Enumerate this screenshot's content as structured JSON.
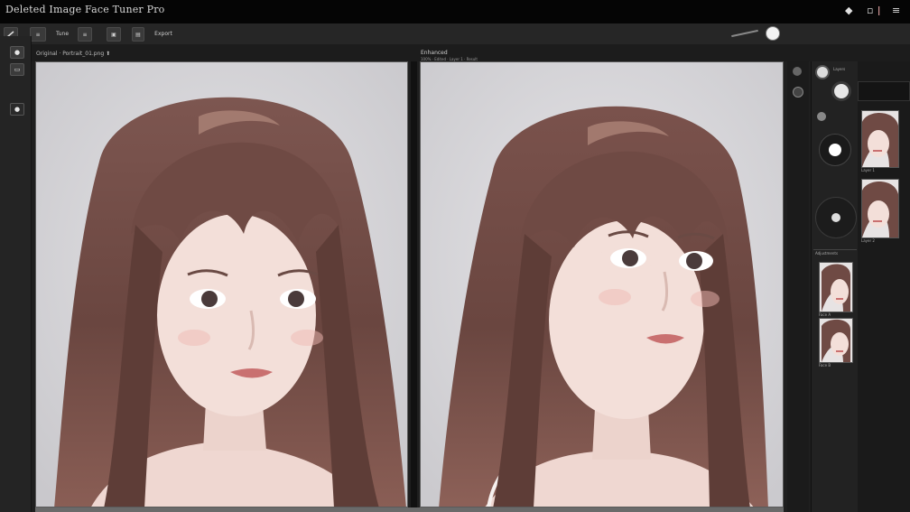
{
  "window": {
    "title": "Deleted Image Face Tuner Pro",
    "controls": [
      "◆",
      "▫",
      "ǀ",
      "≡"
    ]
  },
  "toolbar": {
    "buttons": [
      {
        "id": "tool-a",
        "label": ""
      },
      {
        "id": "tool-b",
        "label": "≡"
      },
      {
        "id": "tool-c",
        "label": "Tune"
      },
      {
        "id": "tool-d",
        "label": "≡"
      },
      {
        "id": "tool-e",
        "label": "▣"
      },
      {
        "id": "tool-f",
        "label": "▤"
      },
      {
        "id": "tool-g",
        "label": "Export"
      }
    ]
  },
  "canvas_left": {
    "tab": "Original · Portrait_01.png  ⬆"
  },
  "canvas_right": {
    "tab": "Enhanced",
    "subtab": "100% · Edited · Layer 1 · Result"
  },
  "panels": {
    "top_label": "Layers",
    "thumbnails": [
      {
        "caption": "Layer 1"
      },
      {
        "caption": "Layer 2"
      },
      {
        "caption": "Face A"
      },
      {
        "caption": "Face B"
      }
    ],
    "section_label": "Adjustments"
  },
  "colors": {
    "hair": "#6f4a44",
    "hair_light": "#a07466",
    "skin": "#f4dfd9",
    "background": "#d6d6d9",
    "lip": "#c97070"
  }
}
